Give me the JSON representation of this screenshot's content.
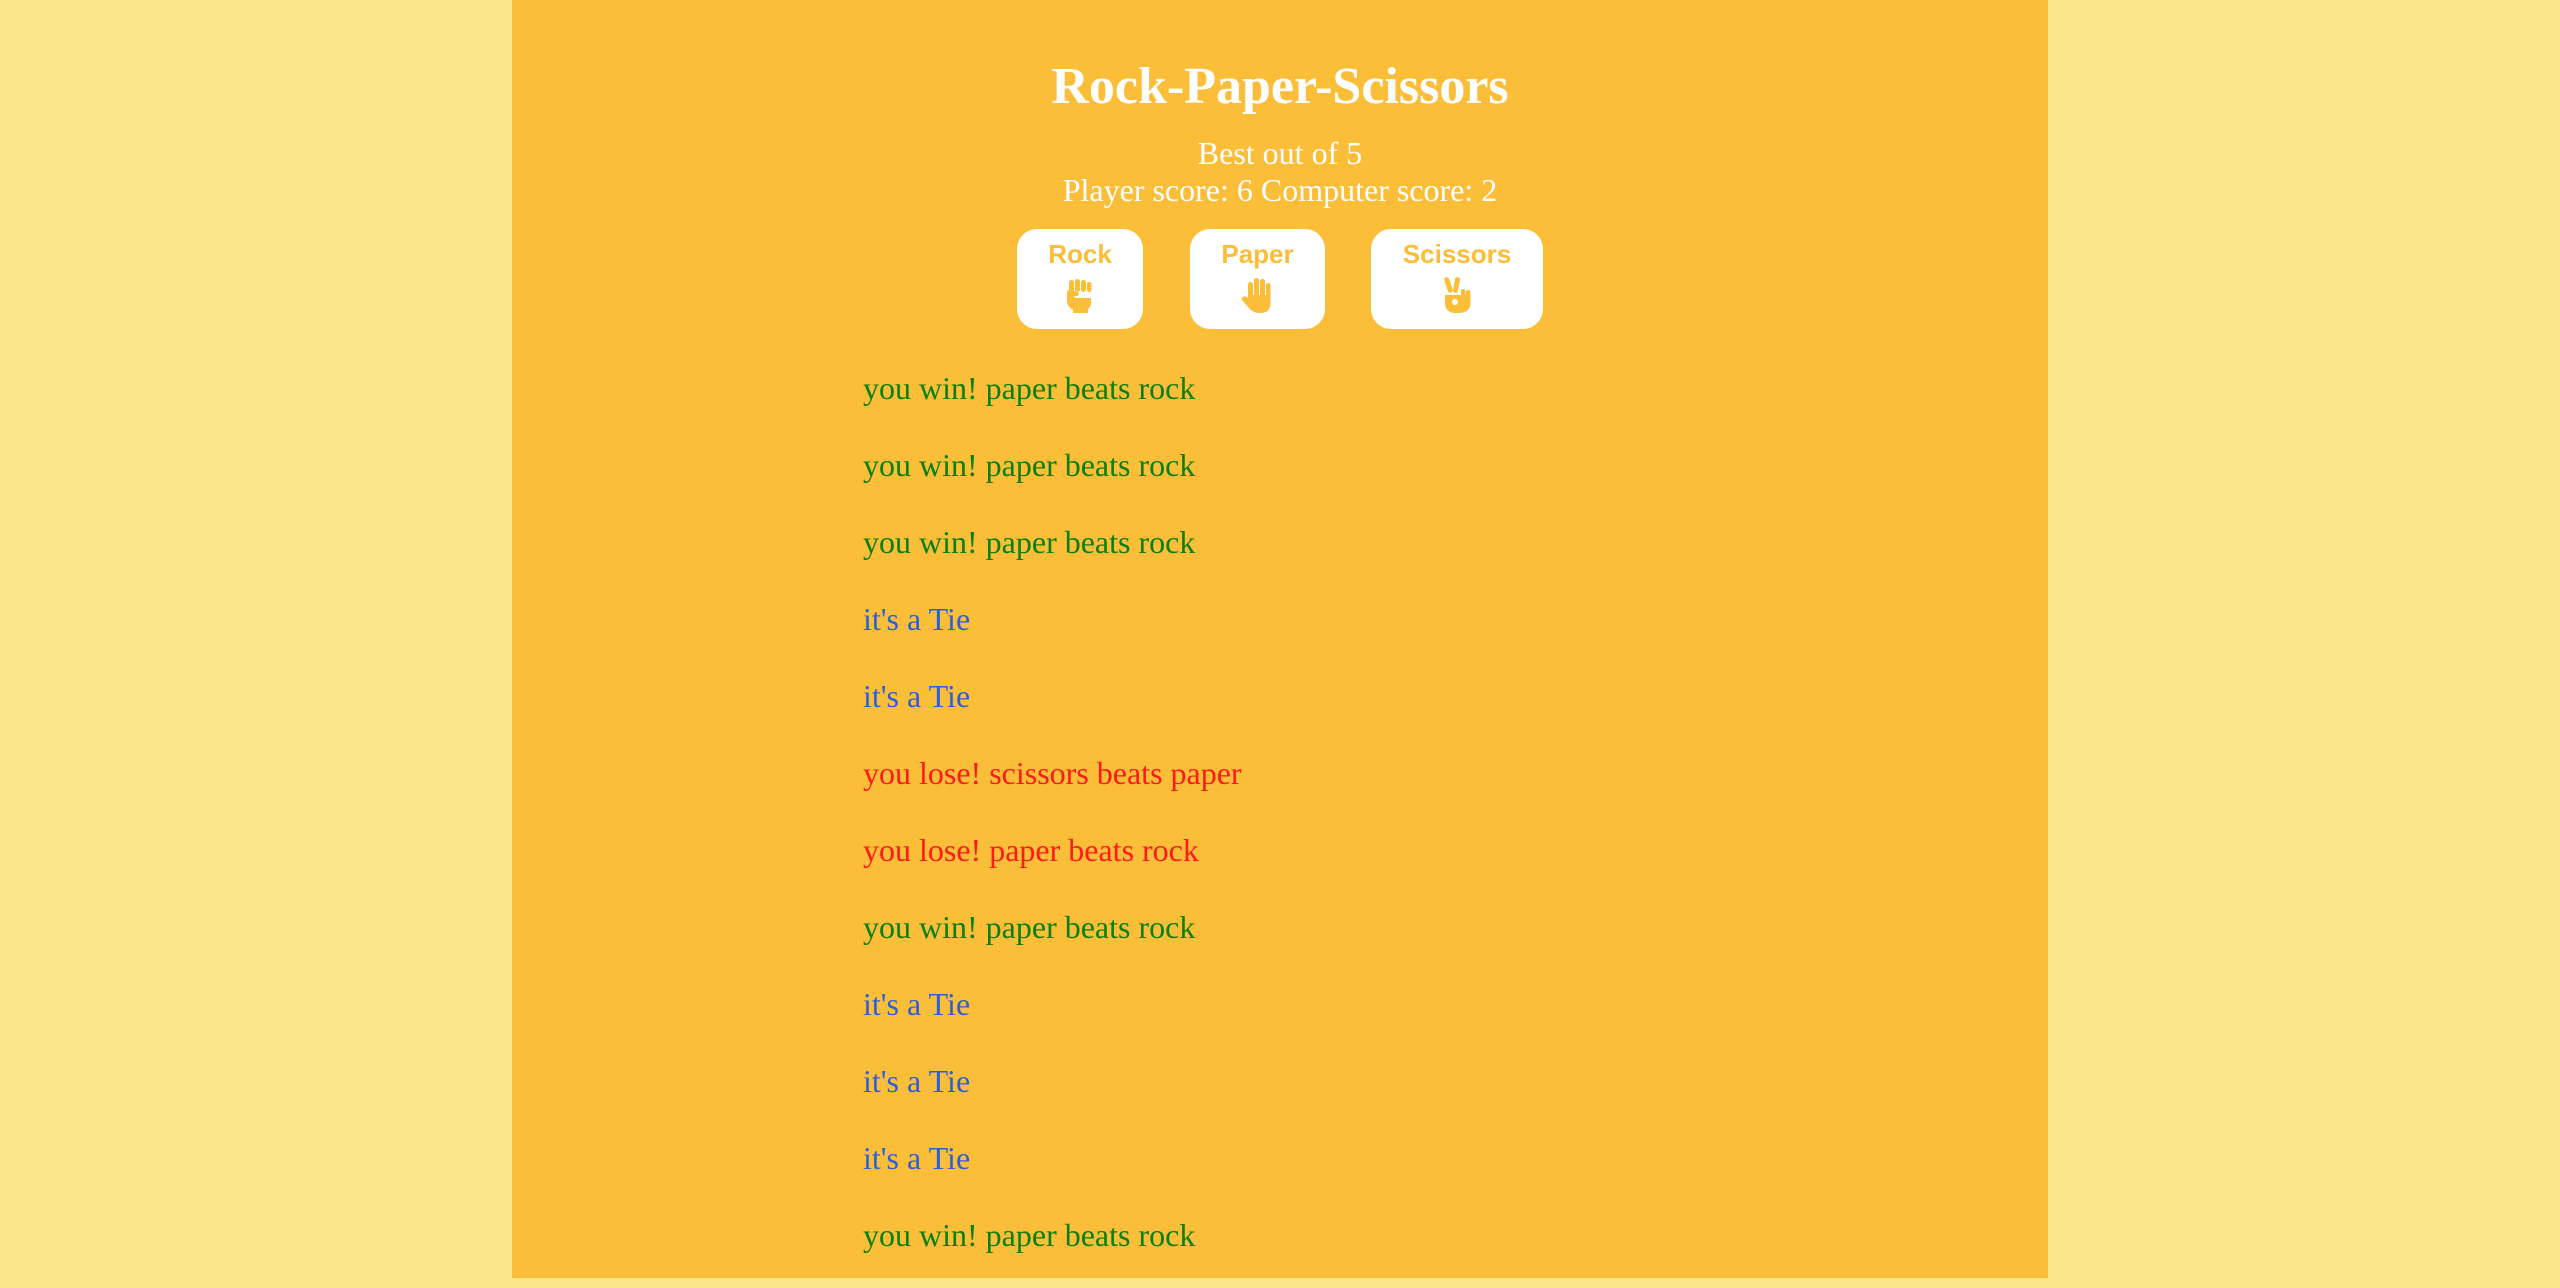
{
  "game": {
    "title": "Rock-Paper-Scissors",
    "best_of": "Best out of 5",
    "score_line": "Player score: 6 Computer score: 2"
  },
  "buttons": [
    {
      "label": "Rock",
      "icon": "fist-icon"
    },
    {
      "label": "Paper",
      "icon": "raised-hand-icon"
    },
    {
      "label": "Scissors",
      "icon": "victory-hand-icon"
    }
  ],
  "results": [
    {
      "text": "you win! paper beats rock",
      "outcome": "win"
    },
    {
      "text": "you win! paper beats rock",
      "outcome": "win"
    },
    {
      "text": "you win! paper beats rock",
      "outcome": "win"
    },
    {
      "text": "it's a Tie",
      "outcome": "tie"
    },
    {
      "text": "it's a Tie",
      "outcome": "tie"
    },
    {
      "text": "you lose! scissors beats paper",
      "outcome": "lose"
    },
    {
      "text": "you lose! paper beats rock",
      "outcome": "lose"
    },
    {
      "text": "you win! paper beats rock",
      "outcome": "win"
    },
    {
      "text": "it's a Tie",
      "outcome": "tie"
    },
    {
      "text": "it's a Tie",
      "outcome": "tie"
    },
    {
      "text": "it's a Tie",
      "outcome": "tie"
    },
    {
      "text": "you win! paper beats rock",
      "outcome": "win"
    }
  ],
  "colors": {
    "page_background": "#fce68c",
    "panel_background": "#fbbe39",
    "button_background": "#ffffff",
    "button_text": "#fbbe39",
    "win": "#0a7f0a",
    "tie": "#2b5fd9",
    "lose": "#ff1a1a"
  }
}
